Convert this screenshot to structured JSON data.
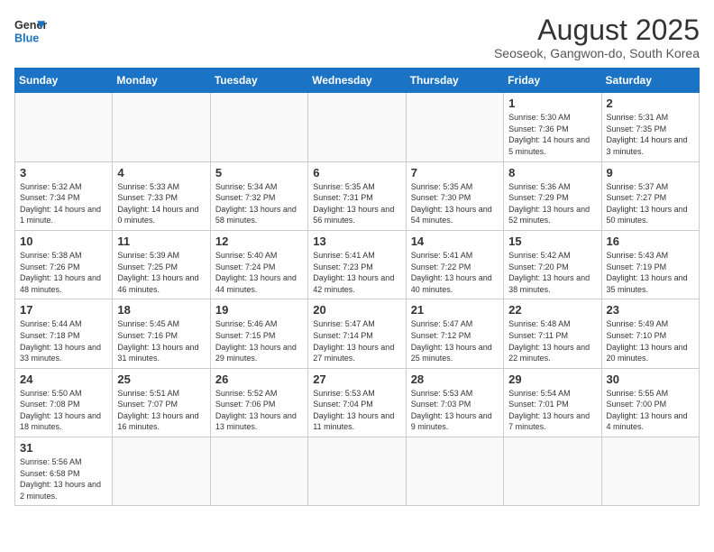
{
  "header": {
    "logo_general": "General",
    "logo_blue": "Blue",
    "title": "August 2025",
    "subtitle": "Seoseok, Gangwon-do, South Korea"
  },
  "weekdays": [
    "Sunday",
    "Monday",
    "Tuesday",
    "Wednesday",
    "Thursday",
    "Friday",
    "Saturday"
  ],
  "weeks": [
    [
      {
        "day": "",
        "info": ""
      },
      {
        "day": "",
        "info": ""
      },
      {
        "day": "",
        "info": ""
      },
      {
        "day": "",
        "info": ""
      },
      {
        "day": "",
        "info": ""
      },
      {
        "day": "1",
        "info": "Sunrise: 5:30 AM\nSunset: 7:36 PM\nDaylight: 14 hours and 5 minutes."
      },
      {
        "day": "2",
        "info": "Sunrise: 5:31 AM\nSunset: 7:35 PM\nDaylight: 14 hours and 3 minutes."
      }
    ],
    [
      {
        "day": "3",
        "info": "Sunrise: 5:32 AM\nSunset: 7:34 PM\nDaylight: 14 hours and 1 minute."
      },
      {
        "day": "4",
        "info": "Sunrise: 5:33 AM\nSunset: 7:33 PM\nDaylight: 14 hours and 0 minutes."
      },
      {
        "day": "5",
        "info": "Sunrise: 5:34 AM\nSunset: 7:32 PM\nDaylight: 13 hours and 58 minutes."
      },
      {
        "day": "6",
        "info": "Sunrise: 5:35 AM\nSunset: 7:31 PM\nDaylight: 13 hours and 56 minutes."
      },
      {
        "day": "7",
        "info": "Sunrise: 5:35 AM\nSunset: 7:30 PM\nDaylight: 13 hours and 54 minutes."
      },
      {
        "day": "8",
        "info": "Sunrise: 5:36 AM\nSunset: 7:29 PM\nDaylight: 13 hours and 52 minutes."
      },
      {
        "day": "9",
        "info": "Sunrise: 5:37 AM\nSunset: 7:27 PM\nDaylight: 13 hours and 50 minutes."
      }
    ],
    [
      {
        "day": "10",
        "info": "Sunrise: 5:38 AM\nSunset: 7:26 PM\nDaylight: 13 hours and 48 minutes."
      },
      {
        "day": "11",
        "info": "Sunrise: 5:39 AM\nSunset: 7:25 PM\nDaylight: 13 hours and 46 minutes."
      },
      {
        "day": "12",
        "info": "Sunrise: 5:40 AM\nSunset: 7:24 PM\nDaylight: 13 hours and 44 minutes."
      },
      {
        "day": "13",
        "info": "Sunrise: 5:41 AM\nSunset: 7:23 PM\nDaylight: 13 hours and 42 minutes."
      },
      {
        "day": "14",
        "info": "Sunrise: 5:41 AM\nSunset: 7:22 PM\nDaylight: 13 hours and 40 minutes."
      },
      {
        "day": "15",
        "info": "Sunrise: 5:42 AM\nSunset: 7:20 PM\nDaylight: 13 hours and 38 minutes."
      },
      {
        "day": "16",
        "info": "Sunrise: 5:43 AM\nSunset: 7:19 PM\nDaylight: 13 hours and 35 minutes."
      }
    ],
    [
      {
        "day": "17",
        "info": "Sunrise: 5:44 AM\nSunset: 7:18 PM\nDaylight: 13 hours and 33 minutes."
      },
      {
        "day": "18",
        "info": "Sunrise: 5:45 AM\nSunset: 7:16 PM\nDaylight: 13 hours and 31 minutes."
      },
      {
        "day": "19",
        "info": "Sunrise: 5:46 AM\nSunset: 7:15 PM\nDaylight: 13 hours and 29 minutes."
      },
      {
        "day": "20",
        "info": "Sunrise: 5:47 AM\nSunset: 7:14 PM\nDaylight: 13 hours and 27 minutes."
      },
      {
        "day": "21",
        "info": "Sunrise: 5:47 AM\nSunset: 7:12 PM\nDaylight: 13 hours and 25 minutes."
      },
      {
        "day": "22",
        "info": "Sunrise: 5:48 AM\nSunset: 7:11 PM\nDaylight: 13 hours and 22 minutes."
      },
      {
        "day": "23",
        "info": "Sunrise: 5:49 AM\nSunset: 7:10 PM\nDaylight: 13 hours and 20 minutes."
      }
    ],
    [
      {
        "day": "24",
        "info": "Sunrise: 5:50 AM\nSunset: 7:08 PM\nDaylight: 13 hours and 18 minutes."
      },
      {
        "day": "25",
        "info": "Sunrise: 5:51 AM\nSunset: 7:07 PM\nDaylight: 13 hours and 16 minutes."
      },
      {
        "day": "26",
        "info": "Sunrise: 5:52 AM\nSunset: 7:06 PM\nDaylight: 13 hours and 13 minutes."
      },
      {
        "day": "27",
        "info": "Sunrise: 5:53 AM\nSunset: 7:04 PM\nDaylight: 13 hours and 11 minutes."
      },
      {
        "day": "28",
        "info": "Sunrise: 5:53 AM\nSunset: 7:03 PM\nDaylight: 13 hours and 9 minutes."
      },
      {
        "day": "29",
        "info": "Sunrise: 5:54 AM\nSunset: 7:01 PM\nDaylight: 13 hours and 7 minutes."
      },
      {
        "day": "30",
        "info": "Sunrise: 5:55 AM\nSunset: 7:00 PM\nDaylight: 13 hours and 4 minutes."
      }
    ],
    [
      {
        "day": "31",
        "info": "Sunrise: 5:56 AM\nSunset: 6:58 PM\nDaylight: 13 hours and 2 minutes."
      },
      {
        "day": "",
        "info": ""
      },
      {
        "day": "",
        "info": ""
      },
      {
        "day": "",
        "info": ""
      },
      {
        "day": "",
        "info": ""
      },
      {
        "day": "",
        "info": ""
      },
      {
        "day": "",
        "info": ""
      }
    ]
  ]
}
